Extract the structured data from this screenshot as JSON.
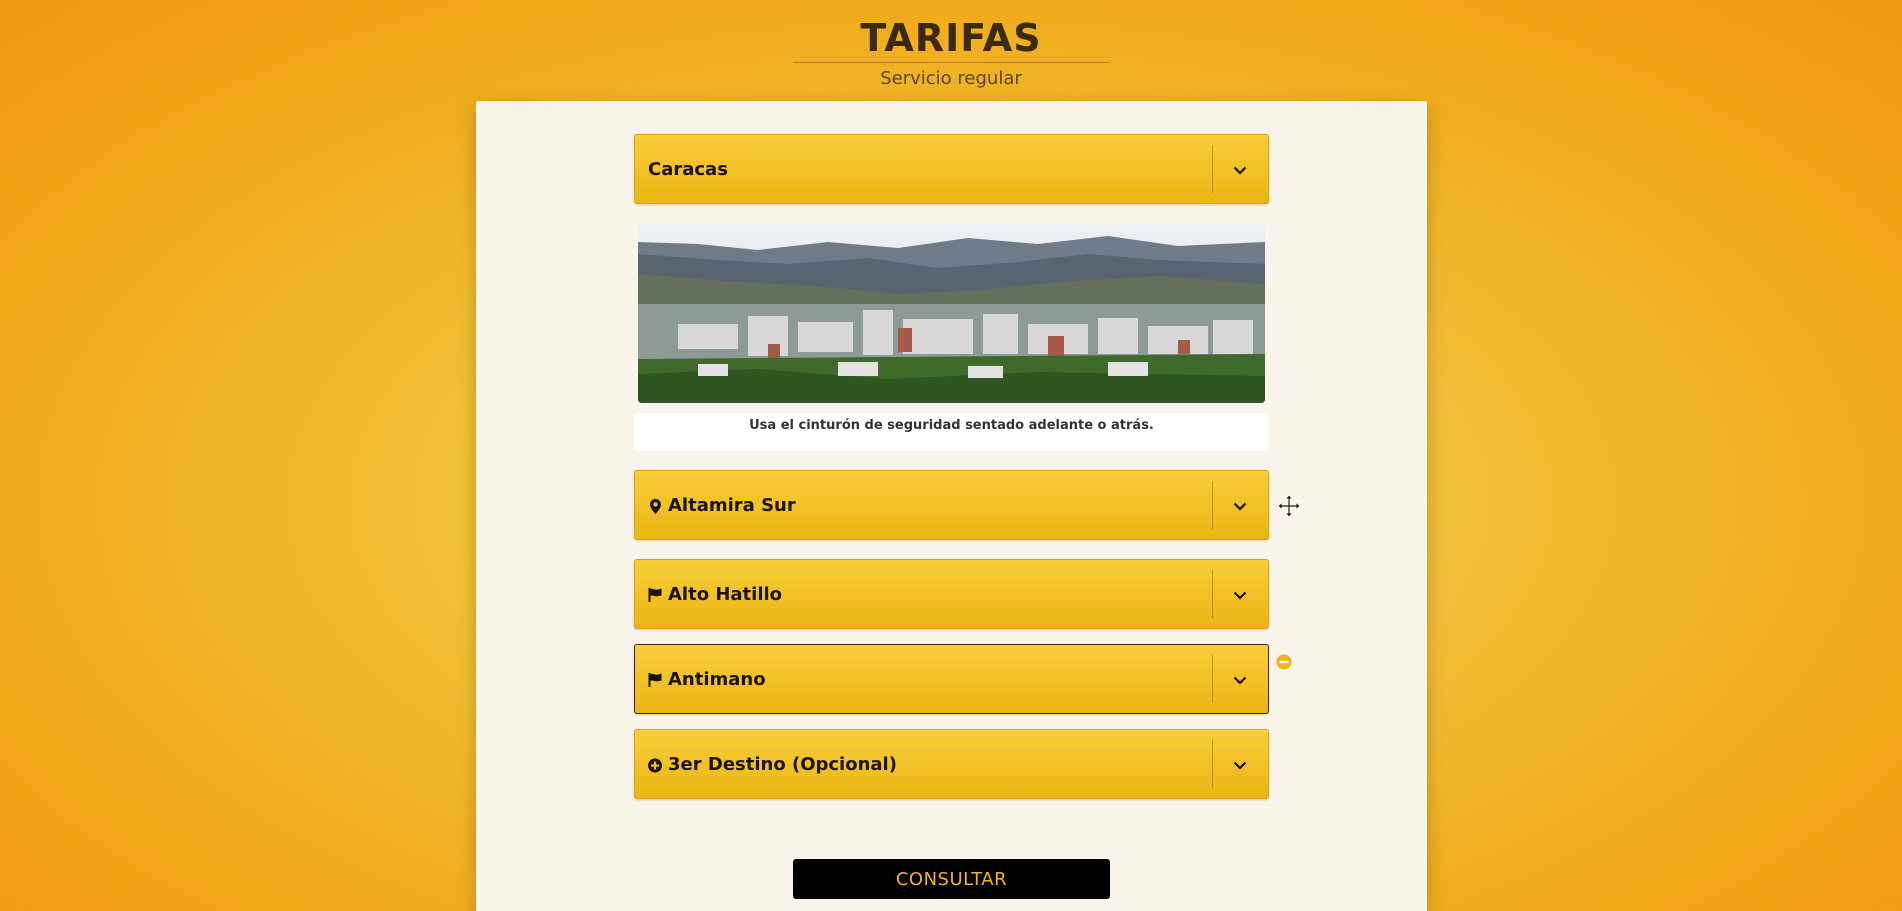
{
  "header": {
    "title": "TARIFAS",
    "subtitle": "Servicio regular"
  },
  "city_select": {
    "value": "Caracas",
    "icon": "chevron-down-icon"
  },
  "city_image": {
    "caption": "Usa el cinturón de seguridad sentado adelante o atrás."
  },
  "origin_select": {
    "value": "Altamira Sur",
    "icon": "map-marker-icon"
  },
  "destination_1_select": {
    "value": "Alto Hatillo",
    "icon": "flag-icon"
  },
  "destination_2_select": {
    "value": "Antimano",
    "icon": "flag-icon"
  },
  "destination_3_select": {
    "value": "3er Destino (Opcional)",
    "icon": "plus-circle-icon"
  },
  "submit_button": {
    "label": "CONSULTAR"
  },
  "colors": {
    "background_accent": "#f0a817",
    "select_fill": "#f2c024",
    "panel": "#faf5ea",
    "button_bg": "#000000",
    "button_text": "#f3b51e",
    "remove_icon": "#f0b21a"
  }
}
